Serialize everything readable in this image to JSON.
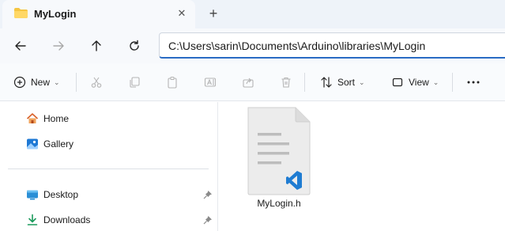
{
  "tab": {
    "title": "MyLogin",
    "close_icon": "close-icon",
    "new_tab_icon": "plus-icon"
  },
  "nav": {
    "back_icon": "arrow-left-icon",
    "forward_icon": "arrow-right-icon",
    "up_icon": "arrow-up-icon",
    "refresh_icon": "refresh-icon",
    "address": "C:\\Users\\sarin\\Documents\\Arduino\\libraries\\MyLogin"
  },
  "commands": {
    "new_label": "New",
    "sort_label": "Sort",
    "view_label": "View",
    "more_icon": "more-icon"
  },
  "sidebar": {
    "items": [
      {
        "label": "Home",
        "icon": "home-icon"
      },
      {
        "label": "Gallery",
        "icon": "gallery-icon"
      },
      {
        "label": "Desktop",
        "icon": "desktop-icon"
      },
      {
        "label": "Downloads",
        "icon": "downloads-icon"
      }
    ]
  },
  "files": [
    {
      "name": "MyLogin.h",
      "icon": "vscode-file-icon"
    }
  ],
  "colors": {
    "accent": "#2a6bc4",
    "folder": "#f5c542",
    "vscode": "#1f7cd2"
  }
}
